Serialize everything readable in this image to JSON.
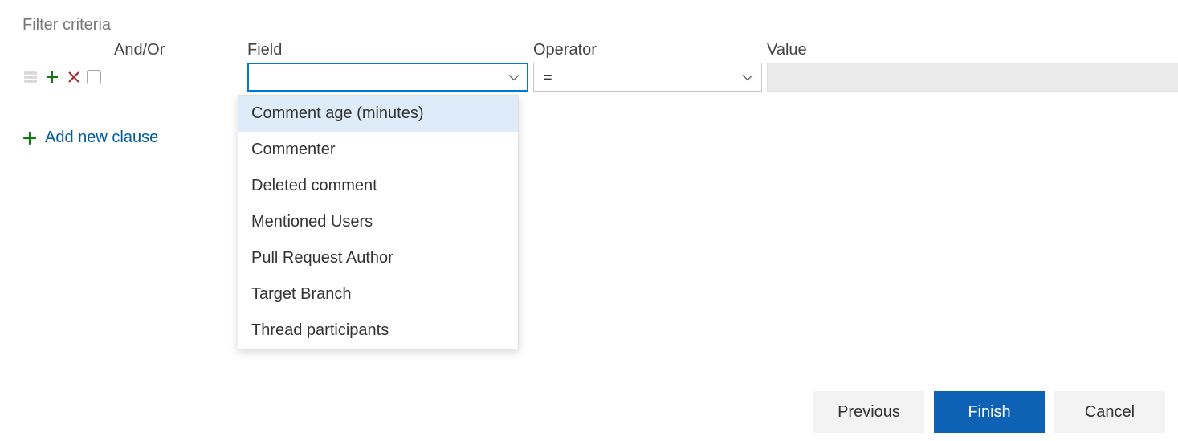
{
  "title": "Filter criteria",
  "headers": {
    "andor": "And/Or",
    "field": "Field",
    "operator": "Operator",
    "value": "Value"
  },
  "row": {
    "field_value": "",
    "operator_value": "=",
    "value_value": ""
  },
  "field_options": [
    "Comment age (minutes)",
    "Commenter",
    "Deleted comment",
    "Mentioned Users",
    "Pull Request Author",
    "Target Branch",
    "Thread participants"
  ],
  "highlighted_option_index": 0,
  "add_clause_label": "Add new clause",
  "buttons": {
    "previous": "Previous",
    "finish": "Finish",
    "cancel": "Cancel"
  }
}
